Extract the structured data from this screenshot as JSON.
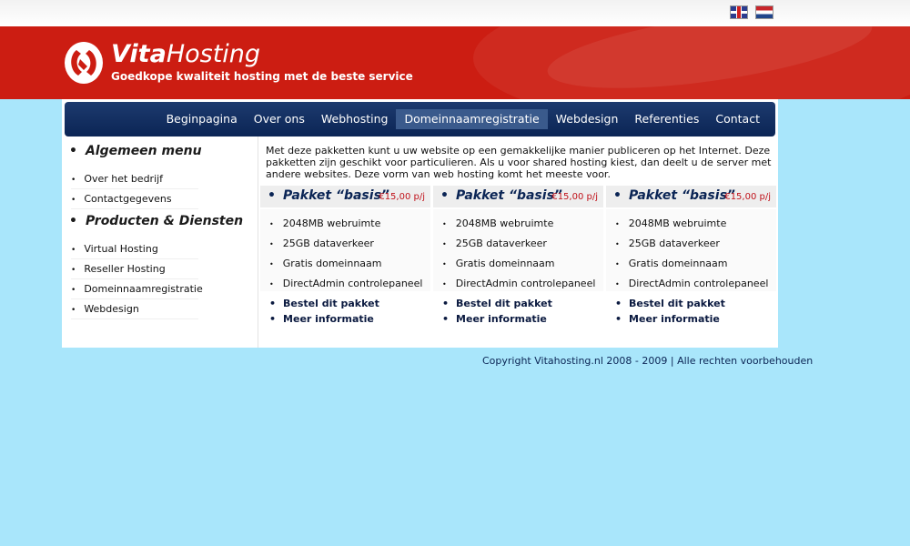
{
  "brand": {
    "name_bold": "Vita",
    "name_rest": "Hosting",
    "tagline": "Goedkope kwaliteit hosting met de beste service"
  },
  "languages": [
    "English",
    "Nederlands"
  ],
  "nav": {
    "items": [
      {
        "label": "Beginpagina"
      },
      {
        "label": "Over ons"
      },
      {
        "label": "Webhosting"
      },
      {
        "label": "Domeinnaamregistratie",
        "active": true
      },
      {
        "label": "Webdesign"
      },
      {
        "label": "Referenties"
      },
      {
        "label": "Contact"
      }
    ]
  },
  "sidebar": {
    "general": {
      "heading": "Algemeen menu",
      "items": [
        "Over het bedrijf",
        "Contactgegevens"
      ]
    },
    "products": {
      "heading": "Producten & Diensten",
      "items": [
        "Virtual Hosting",
        "Reseller Hosting",
        "Domeinnaamregistratie",
        "Webdesign"
      ]
    }
  },
  "intro": "Met deze pakketten kunt u uw website op een gemakkelijke manier publiceren op het Internet. Deze pakketten zijn geschikt voor particulieren. Als u voor shared hosting kiest, dan deelt u de server met andere websites. Deze vorm van web hosting komt het meeste voor.",
  "packages": [
    {
      "title": "Pakket “basis”",
      "price": "€15,00 p/j",
      "features": [
        "2048MB webruimte",
        "25GB dataverkeer",
        "Gratis domeinnaam",
        "DirectAdmin controlepaneel"
      ],
      "order_label": "Bestel dit pakket",
      "info_label": "Meer informatie"
    },
    {
      "title": "Pakket “basis”",
      "price": "€15,00 p/j",
      "features": [
        "2048MB webruimte",
        "25GB dataverkeer",
        "Gratis domeinnaam",
        "DirectAdmin controlepaneel"
      ],
      "order_label": "Bestel dit pakket",
      "info_label": "Meer informatie"
    },
    {
      "title": "Pakket “basis”",
      "price": "€15,00 p/j",
      "features": [
        "2048MB webruimte",
        "25GB dataverkeer",
        "Gratis domeinnaam",
        "DirectAdmin controlepaneel"
      ],
      "order_label": "Bestel dit pakket",
      "info_label": "Meer informatie"
    }
  ],
  "footer": {
    "copyright": "Copyright Vitahosting.nl 2008 - 2009 | Alle rechten voorbehouden"
  },
  "colors": {
    "header_red": "#cc1d12",
    "nav_navy": "#0b2555",
    "background": "#a9e6fb",
    "price_red": "#c0121a"
  }
}
